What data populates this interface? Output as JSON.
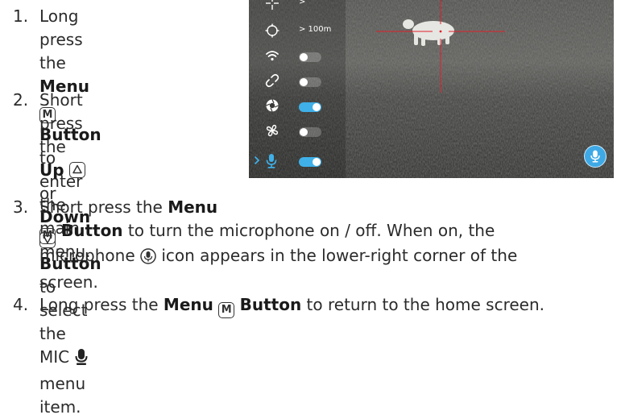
{
  "steps": [
    {
      "num": "1.",
      "parts": {
        "a": "Long press the ",
        "b": "Menu",
        "c": "M",
        "d": " Button",
        "e": " to enter",
        "f": "the main menu."
      }
    },
    {
      "num": "2.",
      "parts": {
        "a": "Short press the",
        "b": "Up",
        "c": "or ",
        "d": "Down",
        "e": "Button",
        "f": " to select the",
        "g": "MIC",
        "h": "menu item."
      }
    },
    {
      "num": "3.",
      "parts": {
        "a": "Short press the ",
        "b": "Menu",
        "c": "M",
        "d": " Button",
        "e": " to turn the microphone on / off. When on, the",
        "f": "microphone ",
        "g": " icon appears in the lower-right corner of the",
        "h": "screen."
      }
    },
    {
      "num": "4.",
      "parts": {
        "a": "Long press the ",
        "b": "Menu",
        "c": "M",
        "d": "Button",
        "e": " to return to the home screen."
      }
    }
  ],
  "screen": {
    "menu": [
      {
        "icon": "reticle-icon",
        "value": ">",
        "toggle": null
      },
      {
        "icon": "rangefinder-icon",
        "value": "> 100m",
        "toggle": null
      },
      {
        "icon": "wifi-icon",
        "value": null,
        "toggle": "off"
      },
      {
        "icon": "link-icon",
        "value": null,
        "toggle": "off"
      },
      {
        "icon": "aperture-icon",
        "value": null,
        "toggle": "on"
      },
      {
        "icon": "fan-icon",
        "value": null,
        "toggle": "off"
      },
      {
        "icon": "microphone-icon",
        "value": null,
        "toggle": "on",
        "selected": true
      }
    ],
    "colors": {
      "accent": "#3fb0e8",
      "reticle": "#e0202a"
    }
  }
}
